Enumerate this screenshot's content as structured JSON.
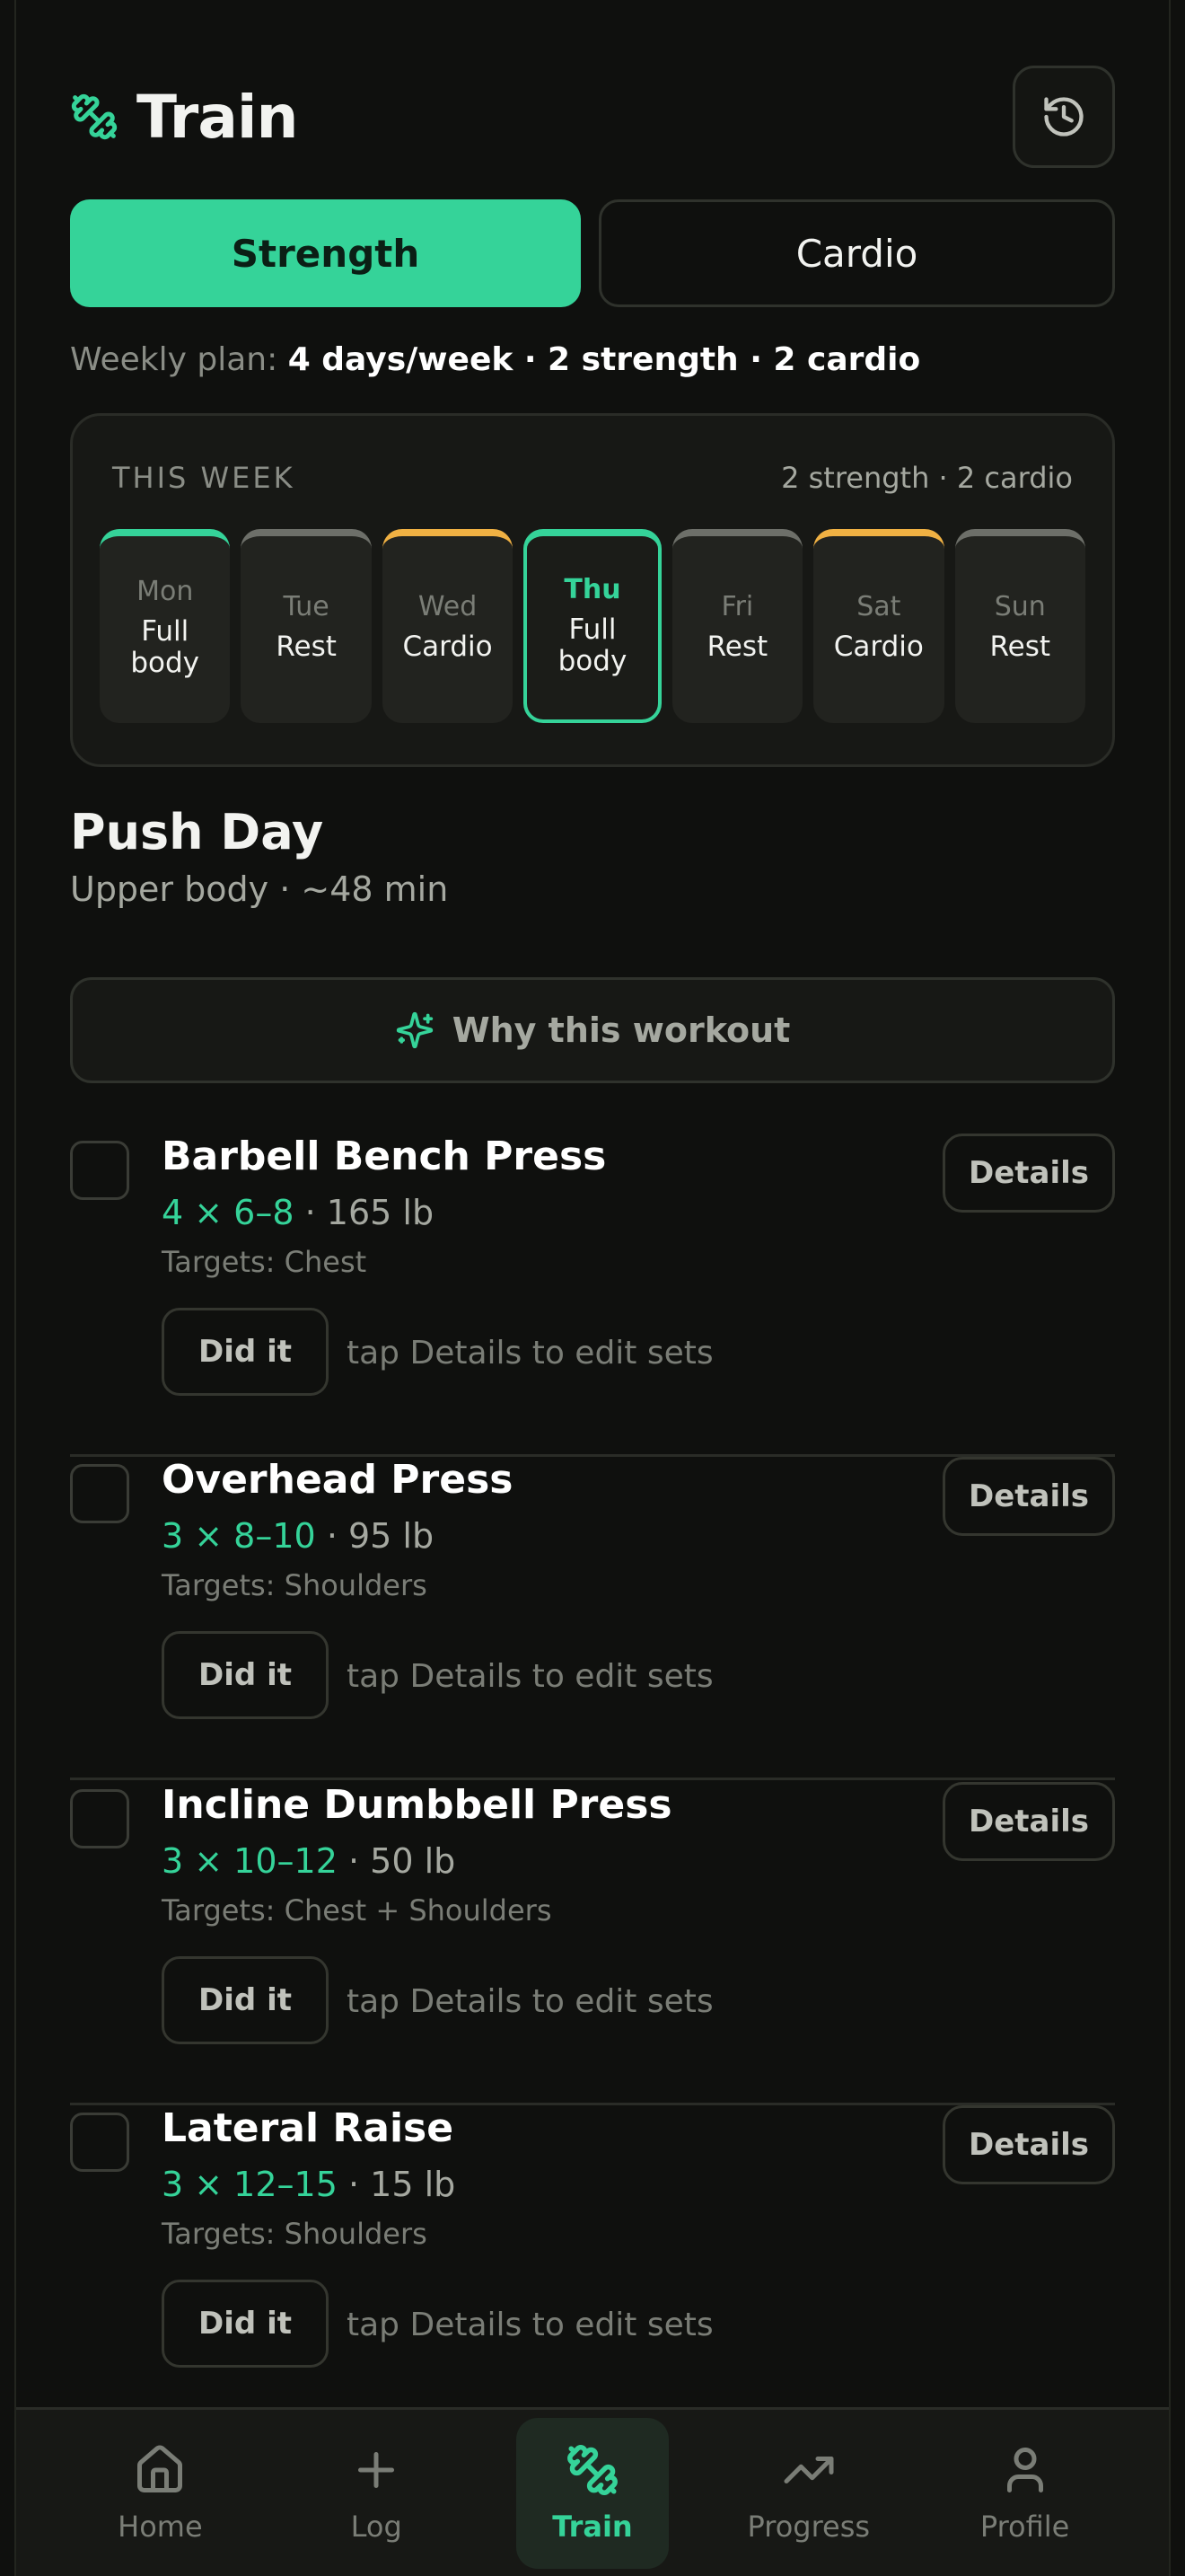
{
  "header": {
    "title": "Train",
    "icon": "dumbbell-icon",
    "history_icon": "history-icon"
  },
  "segments": [
    {
      "label": "Strength",
      "active": true
    },
    {
      "label": "Cardio",
      "active": false
    }
  ],
  "plan": {
    "prefix": "Weekly plan:",
    "value": "4 days/week · 2 strength · 2 cardio"
  },
  "week": {
    "label": "THIS WEEK",
    "summary": "2 strength · 2 cardio",
    "days": [
      {
        "name": "Mon",
        "type": "Full body",
        "kind": "strength"
      },
      {
        "name": "Tue",
        "type": "Rest",
        "kind": "rest"
      },
      {
        "name": "Wed",
        "type": "Cardio",
        "kind": "cardio"
      },
      {
        "name": "Thu",
        "type": "Full body",
        "kind": "strength",
        "today": true
      },
      {
        "name": "Fri",
        "type": "Rest",
        "kind": "rest"
      },
      {
        "name": "Sat",
        "type": "Cardio",
        "kind": "cardio"
      },
      {
        "name": "Sun",
        "type": "Rest",
        "kind": "rest"
      }
    ]
  },
  "workout": {
    "title": "Push Day",
    "subtitle": "Upper body · ~48 min",
    "why_label": "Why this workout"
  },
  "exercises": [
    {
      "name": "Barbell Bench Press",
      "scheme": "4 × 6–8",
      "weight": "· 165 lb",
      "targets": "Targets: Chest",
      "did": "Did it",
      "hint": "tap Details to edit sets",
      "details": "Details"
    },
    {
      "name": "Overhead Press",
      "scheme": "3 × 8–10",
      "weight": "· 95 lb",
      "targets": "Targets: Shoulders",
      "did": "Did it",
      "hint": "tap Details to edit sets",
      "details": "Details"
    },
    {
      "name": "Incline Dumbbell Press",
      "scheme": "3 × 10–12",
      "weight": "· 50 lb",
      "targets": "Targets: Chest + Shoulders",
      "did": "Did it",
      "hint": "tap Details to edit sets",
      "details": "Details"
    },
    {
      "name": "Lateral Raise",
      "scheme": "3 × 12–15",
      "weight": "· 15 lb",
      "targets": "Targets: Shoulders",
      "did": "Did it",
      "hint": "tap Details to edit sets",
      "details": "Details"
    }
  ],
  "tabs": [
    {
      "label": "Home",
      "icon": "home-icon",
      "active": false
    },
    {
      "label": "Log",
      "icon": "plus-icon",
      "active": false
    },
    {
      "label": "Train",
      "icon": "dumbbell-icon",
      "active": true
    },
    {
      "label": "Progress",
      "icon": "trending-up-icon",
      "active": false
    },
    {
      "label": "Profile",
      "icon": "person-icon",
      "active": false
    }
  ],
  "colors": {
    "accent": "#35d399",
    "cardio": "#f0b143",
    "background": "#0f100e"
  }
}
